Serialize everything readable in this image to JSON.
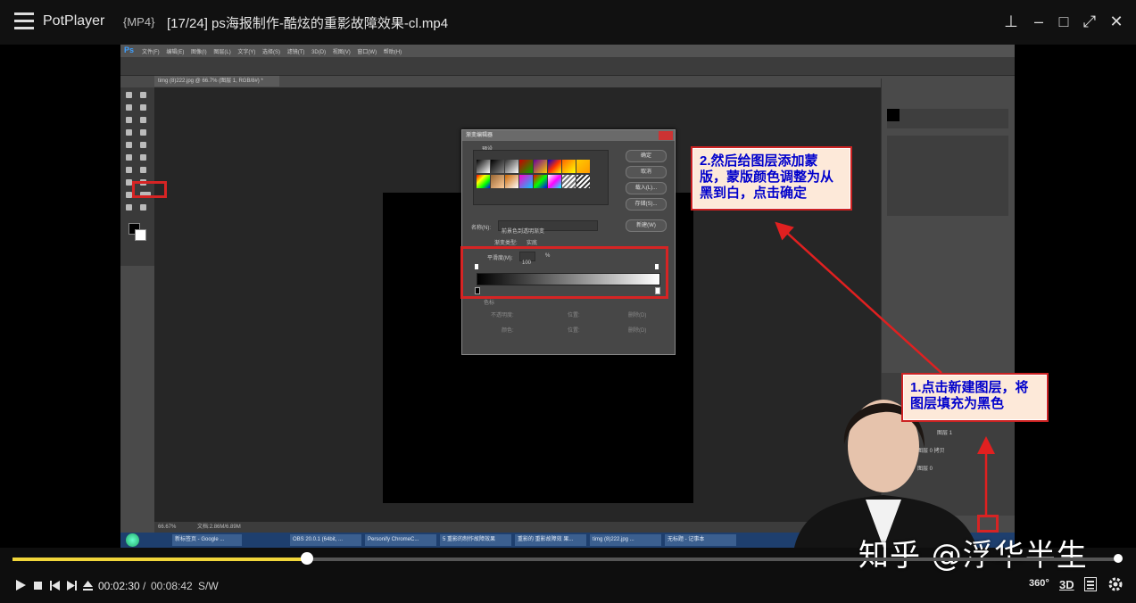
{
  "titlebar": {
    "app_name": "PotPlayer",
    "format": "{MP4}",
    "file_title": "[17/24] ps海报制作-酷炫的重影故障效果-cl.mp4"
  },
  "photoshop": {
    "menus": [
      "文件(F)",
      "编辑(E)",
      "图像(I)",
      "图层(L)",
      "文字(Y)",
      "选择(S)",
      "滤镜(T)",
      "3D(D)",
      "视图(V)",
      "窗口(W)",
      "帮助(H)"
    ],
    "tab_label": "timg (8)222.jpg @ 66.7% (图层 1, RGB/8#) *",
    "status_zoom": "66.67%",
    "status_doc": "文档:2.86M/6.89M",
    "taskbar_items": [
      "新标签页 - Google ...",
      "",
      "OBS 20.0.1 (64bit, ...",
      "Personify ChromeC...",
      "5 重影的制作故障效果",
      "重影的 重影故障效 果...",
      "timg (8)222.jpg ...",
      "无标题 - 记事本"
    ]
  },
  "gradient_editor": {
    "title": "渐变编辑器",
    "presets_label": "预设",
    "ok": "确定",
    "cancel": "取消",
    "load": "载入(L)...",
    "save": "存储(S)...",
    "name_label": "名称(N):",
    "name_value": "前景色到透明渐变",
    "new": "新建(W)",
    "type_label": "渐变类型:",
    "type_value": "实底",
    "smoothness_label": "平滑度(M):",
    "smoothness_value": "100",
    "percent": "%",
    "stops_label": "色标",
    "opacity_label": "不透明度:",
    "location_label": "位置:",
    "delete": "删除(D)",
    "color_label": "颜色:"
  },
  "callouts": {
    "step2": "2.然后给图层添加蒙版，蒙版颜色调整为从黑到白，点击确定",
    "step1": "1.点击新建图层，将图层填充为黑色"
  },
  "layers_panel": {
    "layer1": "图层 1",
    "layer0_copy": "图层 0 拷贝",
    "layer0": "图层 0"
  },
  "watermark": "知乎 @浮华半生",
  "playback": {
    "current_time": "00:02:30",
    "separator": "/",
    "total_time": "00:08:42",
    "mode": "S/W",
    "progress": 0.266,
    "btn_360": "360°",
    "btn_3d": "3D"
  },
  "colors": {
    "accent_progress": "#f1d63a",
    "highlight_red": "#d62424",
    "callout_text": "#0000cc",
    "callout_bg": "#fde9d9"
  }
}
